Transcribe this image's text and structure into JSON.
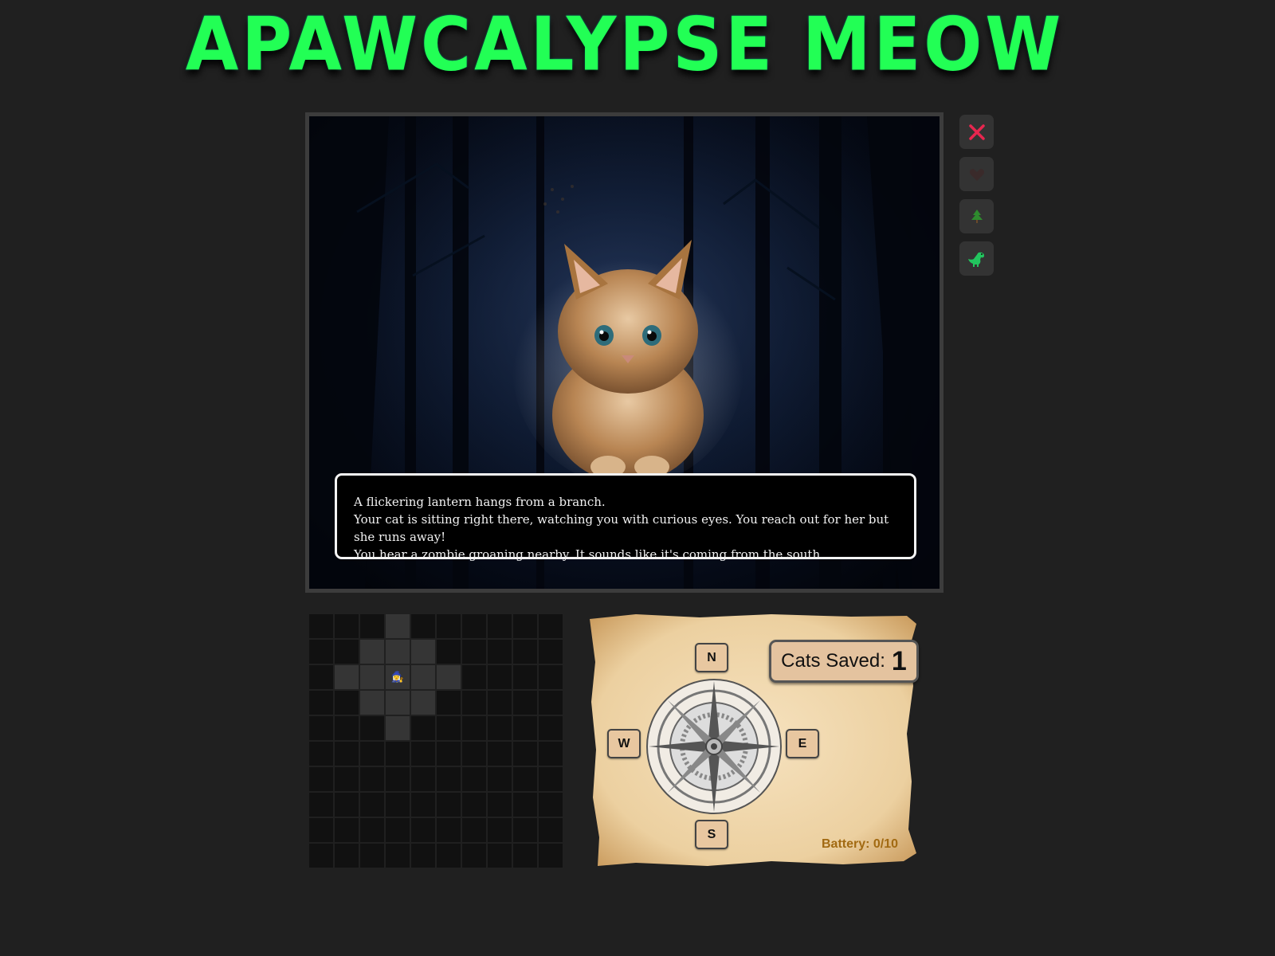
{
  "title": "APAWCALYPSE MEOW",
  "scene": {
    "description_lines": [
      "A flickering lantern hangs from a branch.",
      "Your cat is sitting right there, watching you with curious eyes. You reach out for her but she runs away!",
      "You hear a zombie groaning nearby. It sounds like it's coming from the south."
    ]
  },
  "side_buttons": [
    {
      "icon": "close-icon",
      "color": "#e8264f"
    },
    {
      "icon": "heart-icon",
      "color": "#4a2a2a"
    },
    {
      "icon": "tree-icon",
      "color": "#2e8b2e"
    },
    {
      "icon": "dinosaur-icon",
      "color": "#22c55e"
    }
  ],
  "map": {
    "rows": 10,
    "cols": 10,
    "visited": [
      [
        0,
        3
      ],
      [
        1,
        2
      ],
      [
        1,
        3
      ],
      [
        1,
        4
      ],
      [
        2,
        1
      ],
      [
        2,
        2
      ],
      [
        2,
        3
      ],
      [
        2,
        4
      ],
      [
        2,
        5
      ],
      [
        3,
        2
      ],
      [
        3,
        3
      ],
      [
        3,
        4
      ],
      [
        4,
        3
      ]
    ],
    "player": [
      2,
      3
    ],
    "player_icon": "🧙‍♀️"
  },
  "compass": {
    "north": "N",
    "south": "S",
    "east": "E",
    "west": "W"
  },
  "cats_saved": {
    "label": "Cats Saved:",
    "value": "1"
  },
  "battery": "Battery: 0/10"
}
